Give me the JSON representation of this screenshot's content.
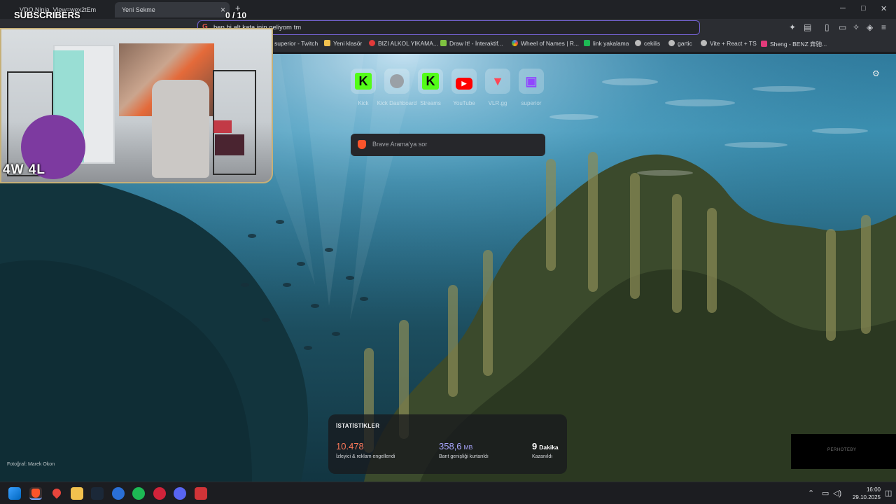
{
  "tabs": [
    {
      "title": "VDO.Ninja_View=wex2tEm"
    },
    {
      "title": "Yeni Sekme",
      "active": true
    }
  ],
  "window_controls": {
    "minimize": "─",
    "maximize": "□",
    "close": "✕"
  },
  "address_bar": {
    "value": "ben bi alt kata inip geliyom tm"
  },
  "bookmarks": [
    {
      "label": "superior - Twitch",
      "color": "#9146ff"
    },
    {
      "label": "Yeni klasör",
      "color": "#f2c14e"
    },
    {
      "label": "BIZI ALKOL YIKAMA...",
      "color": "#e23a3a"
    },
    {
      "label": "Draw It! - İnteraktif...",
      "color": "#7fc241"
    },
    {
      "label": "Wheel of Names | R...",
      "color": "#4285f4"
    },
    {
      "label": "link yakalama",
      "color": "#1db954"
    },
    {
      "label": "cekilis",
      "color": "#bbbbbb"
    },
    {
      "label": "gartic",
      "color": "#bbbbbb"
    },
    {
      "label": "Vite + React + TS",
      "color": "#bbbbbb"
    },
    {
      "label": "Sheng - BENZ 奔驰...",
      "color": "#e23a7a"
    }
  ],
  "overlay": {
    "subscribers_label": "SUBSCRIBERS",
    "subscribers_count": "0 / 10",
    "score": "4W 4L"
  },
  "shortcuts": [
    {
      "label": "Kick",
      "glyph": "K",
      "bg": "#53fc18",
      "fg": "#0b0b0b"
    },
    {
      "label": "Kick Dashboard",
      "glyph": "●",
      "bg": "#9aa0a6",
      "fg": "#5f6368"
    },
    {
      "label": "Streams",
      "glyph": "K",
      "bg": "#53fc18",
      "fg": "#0b0b0b"
    },
    {
      "label": "YouTube",
      "glyph": "▶",
      "bg": "#ff0000",
      "fg": "#ffffff"
    },
    {
      "label": "VLR.gg",
      "glyph": "▼",
      "bg": "#ff4655",
      "fg": "#ffffff"
    },
    {
      "label": "superior",
      "glyph": "▣",
      "bg": "#9146ff",
      "fg": "#ffffff"
    }
  ],
  "search": {
    "placeholder": "Brave Arama'ya sor"
  },
  "stats": {
    "title": "İSTATİSTİKLER",
    "items": [
      {
        "value": "10.478",
        "unit": "",
        "label": "İzleyici & reklam engellendi",
        "color": "#ff7a5a"
      },
      {
        "value": "358,6",
        "unit": "MB",
        "label": "Bant genişliği kurtarıldı",
        "color": "#a9a6ff"
      },
      {
        "value": "9",
        "unit": "Dakika",
        "label": "Kazanıldı",
        "color": "#ffffff"
      }
    ]
  },
  "photo_credit": "Fotoğraf: Marek Okon",
  "black_box_text": "PERHOTEBY",
  "clock": {
    "time": "16:00",
    "date": "29.10.2025"
  }
}
